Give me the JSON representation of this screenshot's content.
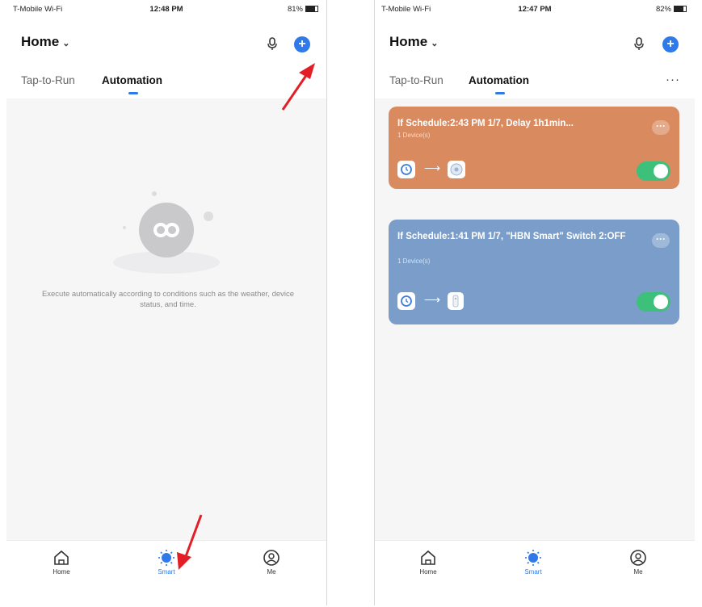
{
  "colors": {
    "accent": "#2f7ae8",
    "card_orange": "#d98a5f",
    "card_blue": "#7a9ec9",
    "toggle_on": "#3cc07a",
    "arrow_red": "#e21f26"
  },
  "left": {
    "status": {
      "carrier": "T-Mobile Wi-Fi",
      "time": "12:48 PM",
      "battery": "81%"
    },
    "header": {
      "title": "Home"
    },
    "tabs": [
      {
        "label": "Tap-to-Run"
      },
      {
        "label": "Automation"
      }
    ],
    "empty": {
      "message": "Execute automatically according to conditions such as the weather, device status, and time."
    },
    "nav": [
      {
        "label": "Home"
      },
      {
        "label": "Smart"
      },
      {
        "label": "Me"
      }
    ]
  },
  "right": {
    "status": {
      "carrier": "T-Mobile Wi-Fi",
      "time": "12:47 PM",
      "battery": "82%"
    },
    "header": {
      "title": "Home"
    },
    "tabs": [
      {
        "label": "Tap-to-Run"
      },
      {
        "label": "Automation"
      }
    ],
    "more": "···",
    "cards": [
      {
        "title": "If Schedule:2:43 PM 1/7, Delay 1h1min...",
        "subtitle": "1 Device(s)",
        "enabled": true
      },
      {
        "title": "If Schedule:1:41 PM 1/7, \"HBN Smart\" Switch 2:OFF",
        "subtitle": "1 Device(s)",
        "enabled": true
      }
    ],
    "nav": [
      {
        "label": "Home"
      },
      {
        "label": "Smart"
      },
      {
        "label": "Me"
      }
    ]
  }
}
